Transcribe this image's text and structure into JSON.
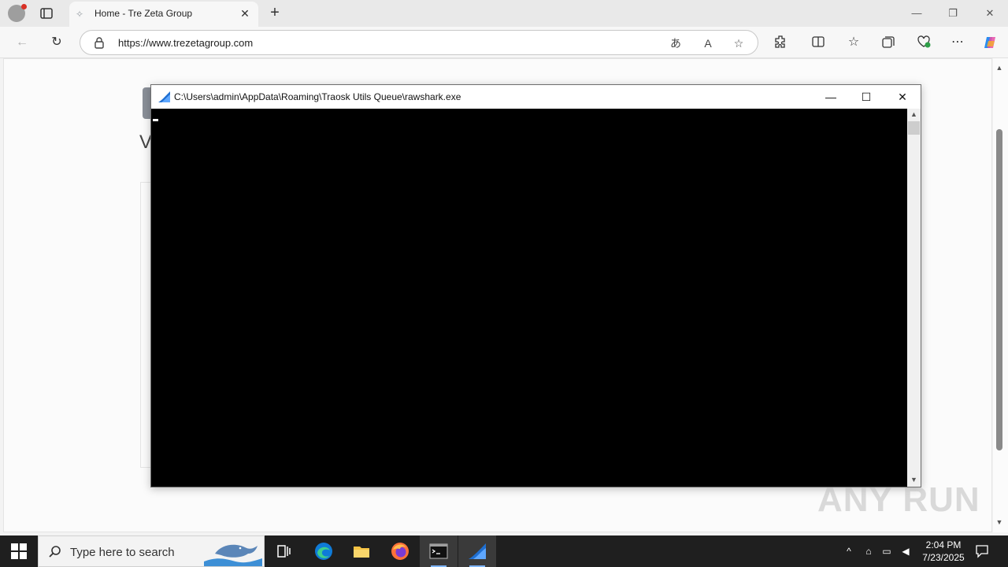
{
  "browser": {
    "tab": {
      "title": "Home - Tre Zeta Group"
    },
    "address": {
      "url": "https://www.trezetagroup.com"
    }
  },
  "page": {
    "heading_fragment": "V"
  },
  "console": {
    "title": "C:\\Users\\admin\\AppData\\Roaming\\Traosk Utils Queue\\rawshark.exe"
  },
  "taskbar": {
    "search_placeholder": "Type here to search",
    "time": "2:04 PM",
    "date": "7/23/2025"
  },
  "watermark": "ANY RUN",
  "colors": {
    "console_bg": "#000000",
    "taskbar_bg": "#1f1f1f",
    "edge_blue": "#0f7bd8",
    "firefox_orange": "#ff7139",
    "shark_blue": "#1f6fd1"
  }
}
